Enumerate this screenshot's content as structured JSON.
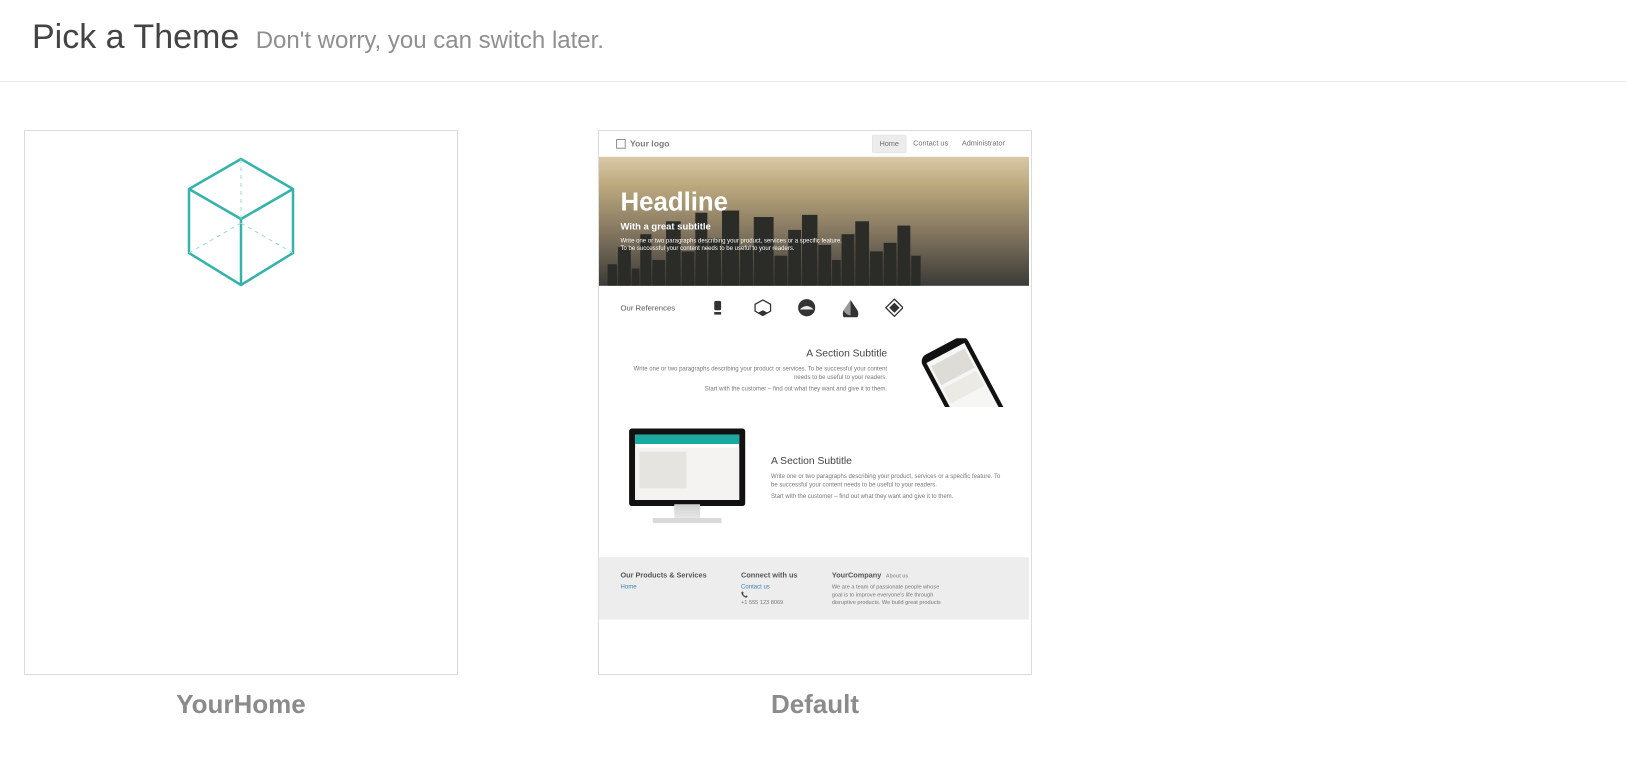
{
  "header": {
    "title": "Pick a Theme",
    "subtitle": "Don't worry, you can switch later."
  },
  "themes": [
    {
      "id": "yourhome",
      "name": "YourHome"
    },
    {
      "id": "default",
      "name": "Default"
    }
  ],
  "preview_default": {
    "logo_text": "Your logo",
    "nav": {
      "home": "Home",
      "contact": "Contact us",
      "admin": "Administrator"
    },
    "hero": {
      "headline": "Headline",
      "subtitle": "With a great subtitle",
      "body": "Write one or two paragraphs describing your product, services or a specific feature. To be successful your content needs to be useful to your readers."
    },
    "references_label": "Our References",
    "section1": {
      "title": "A Section Subtitle",
      "p1": "Write one or two paragraphs describing your product or services. To be successful your content needs to be useful to your readers.",
      "p2": "Start with the customer – find out what they want and give it to them."
    },
    "section2": {
      "title": "A Section Subtitle",
      "p1": "Write one or two paragraphs describing your product, services or a specific feature. To be successful your content needs to be useful to your readers.",
      "p2": "Start with the customer – find out what they want and give it to them."
    },
    "footer": {
      "col1_title": "Our Products & Services",
      "col1_link": "Home",
      "col2_title": "Connect with us",
      "col2_link": "Contact us",
      "col2_phone": "+1 555 123 8069",
      "col3_company": "YourCompany",
      "col3_tag": "About us",
      "col3_body": "We are a team of passionate people whose goal is to improve everyone's life through disruptive products. We build great products"
    }
  }
}
